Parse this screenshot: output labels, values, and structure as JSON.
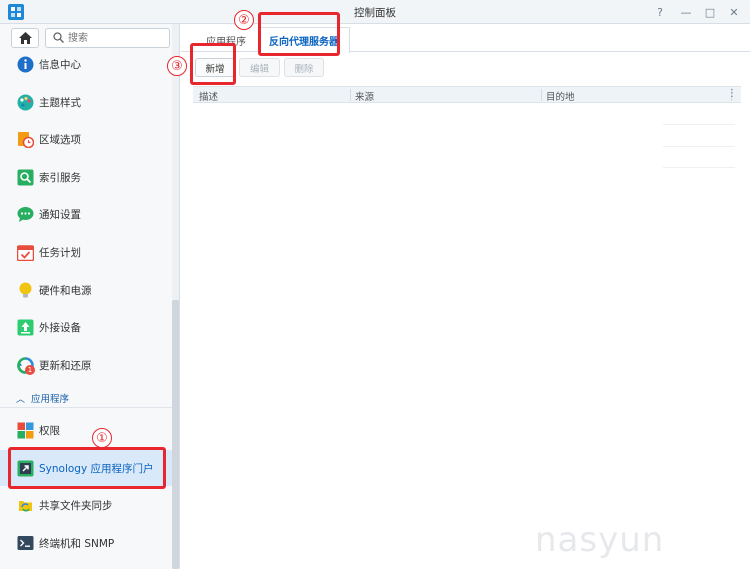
{
  "window": {
    "title": "控制面板",
    "buttons": {
      "help": "?",
      "min": "—",
      "max": "□",
      "close": "✕"
    }
  },
  "sidebar": {
    "search_placeholder": "搜索",
    "items": [
      {
        "label": "信息中心",
        "icon": "info-icon",
        "color": "#1f6fc9"
      },
      {
        "label": "主题样式",
        "icon": "palette-icon",
        "color": "#23b0a6"
      },
      {
        "label": "区域选项",
        "icon": "region-clock-icon",
        "color": "#f39c12"
      },
      {
        "label": "索引服务",
        "icon": "index-search-icon",
        "color": "#27ae60"
      },
      {
        "label": "通知设置",
        "icon": "chat-bubble-icon",
        "color": "#27ae60"
      },
      {
        "label": "任务计划",
        "icon": "calendar-icon",
        "color": "#e74c3c"
      },
      {
        "label": "硬件和电源",
        "icon": "lightbulb-icon",
        "color": "#f1c40f"
      },
      {
        "label": "外接设备",
        "icon": "external-device-icon",
        "color": "#2ecc71"
      },
      {
        "label": "更新和还原",
        "icon": "update-restore-icon",
        "color": "#2d8bd9",
        "badge": "1"
      }
    ],
    "section_title": "应用程序",
    "app_items": [
      {
        "label": "权限",
        "icon": "permission-blocks-icon"
      },
      {
        "label": "Synology 应用程序门户",
        "icon": "app-portal-icon"
      },
      {
        "label": "共享文件夹同步",
        "icon": "folder-sync-icon"
      },
      {
        "label": "终端机和 SNMP",
        "icon": "terminal-icon"
      }
    ]
  },
  "tabs": [
    {
      "label": "应用程序",
      "selected": false
    },
    {
      "label": "反向代理服务器",
      "selected": true
    }
  ],
  "toolbar": {
    "create": "新增",
    "edit": "编辑",
    "delete": "删除"
  },
  "table": {
    "columns": [
      "描述",
      "来源",
      "目的地"
    ]
  },
  "annotations": [
    "①",
    "②",
    "③"
  ],
  "watermark": "nasyun",
  "colors": {
    "accent": "#0a63c0",
    "marker": "#e8262d",
    "active_bg": "#d9e9f9"
  }
}
